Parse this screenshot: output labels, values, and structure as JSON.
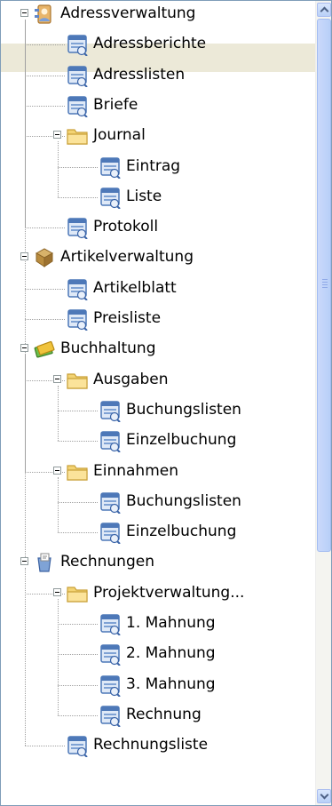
{
  "tree": {
    "nodes": [
      {
        "label": "Adressverwaltung",
        "level": 0,
        "icon": "address-book-icon",
        "expanded": true
      },
      {
        "label": "Adressberichte",
        "level": 1,
        "icon": "report-icon",
        "selected": true
      },
      {
        "label": "Adresslisten",
        "level": 1,
        "icon": "report-icon"
      },
      {
        "label": "Briefe",
        "level": 1,
        "icon": "report-icon"
      },
      {
        "label": "Journal",
        "level": 1,
        "icon": "folder-icon",
        "expanded": true
      },
      {
        "label": "Eintrag",
        "level": 2,
        "icon": "report-icon"
      },
      {
        "label": "Liste",
        "level": 2,
        "icon": "report-icon"
      },
      {
        "label": "Protokoll",
        "level": 1,
        "icon": "report-icon"
      },
      {
        "label": "Artikelverwaltung",
        "level": 0,
        "icon": "box-icon",
        "expanded": true
      },
      {
        "label": "Artikelblatt",
        "level": 1,
        "icon": "report-icon"
      },
      {
        "label": "Preisliste",
        "level": 1,
        "icon": "report-icon"
      },
      {
        "label": "Buchhaltung",
        "level": 0,
        "icon": "money-icon",
        "expanded": true
      },
      {
        "label": "Ausgaben",
        "level": 1,
        "icon": "folder-icon",
        "expanded": true
      },
      {
        "label": "Buchungslisten",
        "level": 2,
        "icon": "report-icon"
      },
      {
        "label": "Einzelbuchung",
        "level": 2,
        "icon": "report-icon"
      },
      {
        "label": "Einnahmen",
        "level": 1,
        "icon": "folder-icon",
        "expanded": true
      },
      {
        "label": "Buchungslisten",
        "level": 2,
        "icon": "report-icon"
      },
      {
        "label": "Einzelbuchung",
        "level": 2,
        "icon": "report-icon"
      },
      {
        "label": "Rechnungen",
        "level": 0,
        "icon": "invoice-icon",
        "expanded": true
      },
      {
        "label": "Projektverwaltung...",
        "level": 1,
        "icon": "folder-icon",
        "expanded": true
      },
      {
        "label": "1. Mahnung",
        "level": 2,
        "icon": "report-icon"
      },
      {
        "label": "2. Mahnung",
        "level": 2,
        "icon": "report-icon"
      },
      {
        "label": "3. Mahnung",
        "level": 2,
        "icon": "report-icon"
      },
      {
        "label": "Rechnung",
        "level": 2,
        "icon": "report-icon"
      },
      {
        "label": "Rechnungsliste",
        "level": 1,
        "icon": "report-icon"
      }
    ]
  },
  "scrollbar": {
    "position": 0.0,
    "visible_fraction": 0.68
  },
  "colors": {
    "selection": "#ece9d8",
    "border": "#7f9db9",
    "scrollbar": "#b9d0f7"
  }
}
